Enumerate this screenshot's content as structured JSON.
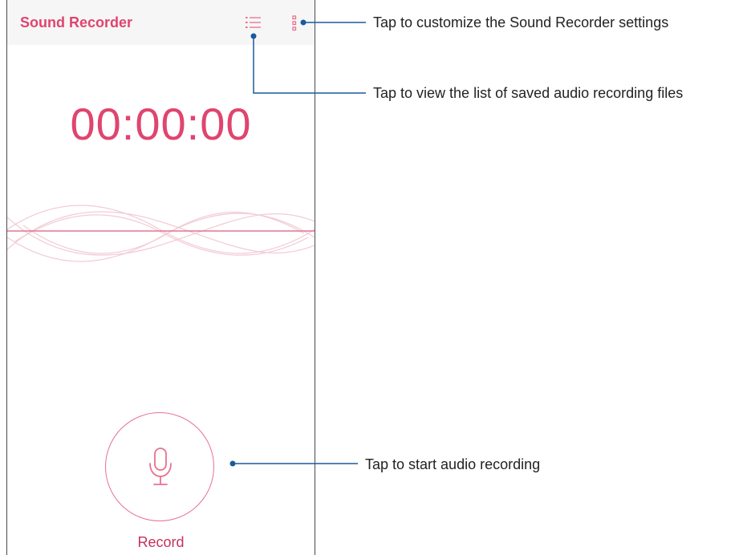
{
  "app_bar": {
    "title": "Sound Recorder",
    "list_icon": "list-icon",
    "menu_icon": "more-vert-icon"
  },
  "timer": {
    "value": "00:00:00"
  },
  "record": {
    "icon": "microphone-icon",
    "label": "Record"
  },
  "callouts": {
    "settings": "Tap to customize the Sound Recorder settings",
    "list": "Tap to view the list of saved audio recording files",
    "record": "Tap to start audio recording"
  },
  "colors": {
    "accent": "#e0446f",
    "callout_line": "#1a5a9c",
    "frame": "#4a4a4a"
  }
}
